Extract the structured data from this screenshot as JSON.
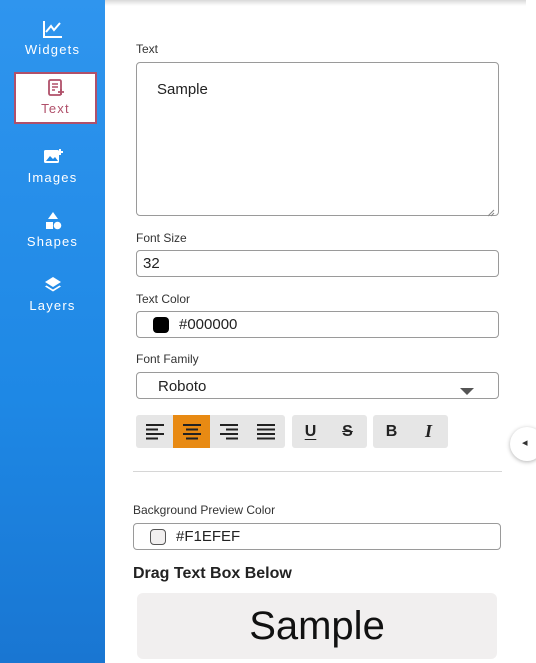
{
  "sidebar": {
    "items": [
      {
        "label": "Widgets",
        "icon": "chart-line-icon"
      },
      {
        "label": "Text",
        "icon": "text-add-icon",
        "active": true
      },
      {
        "label": "Images",
        "icon": "image-add-icon"
      },
      {
        "label": "Shapes",
        "icon": "shapes-icon"
      },
      {
        "label": "Layers",
        "icon": "layers-icon"
      }
    ],
    "active_color": "#b0506a",
    "background": "#1e88e5"
  },
  "form": {
    "text_label": "Text",
    "text_value": "Sample",
    "font_size_label": "Font Size",
    "font_size_value": "32",
    "text_color_label": "Text Color",
    "text_color_value": "#000000",
    "font_family_label": "Font Family",
    "font_family_value": "Roboto",
    "background_label": "Background Preview Color",
    "background_value": "#F1EFEF",
    "drag_heading": "Drag Text Box Below",
    "preview_text": "Sample"
  },
  "toolbar": {
    "align": [
      "align-left",
      "align-center",
      "align-right",
      "align-justify"
    ],
    "active_align": "align-center",
    "underline_label": "U",
    "strikethrough_label": "S",
    "bold_label": "B",
    "italic_label": "I",
    "accent": "#e88a13"
  }
}
